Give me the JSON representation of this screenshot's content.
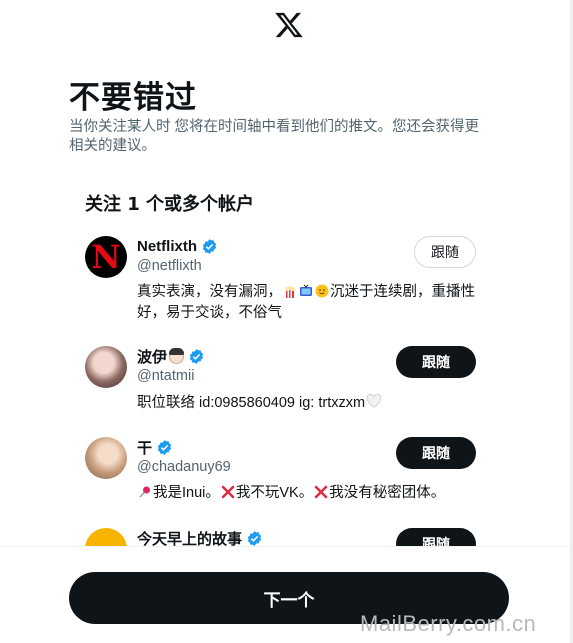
{
  "header": {
    "logo_icon": "x-logo-icon"
  },
  "intro": {
    "headline": "不要错过",
    "subtext": "当你关注某人时 您将在时间轴中看到他们的推文。您还会获得更相关的建议。"
  },
  "section": {
    "title": "关注 1 个或多个帐户"
  },
  "accounts": [
    {
      "name": "Netflixth",
      "handle": "@netflixth",
      "bio_parts": [
        "真实表演，没有漏洞，",
        "沉迷于连续剧，重播性好，易于交谈，不俗气"
      ],
      "bio_emojis": [
        "popcorn-icon",
        "tv-icon",
        "slightly-smiling-face-icon"
      ],
      "button_label": "跟随",
      "button_state": "following-outline"
    },
    {
      "name": "波伊",
      "name_emoji": "woman-face-icon",
      "handle": "@ntatmii",
      "bio": "职位联络 id:0985860409 ig: trtxzxm",
      "bio_emoji": "white-heart-icon",
      "button_label": "跟随",
      "button_state": "solid"
    },
    {
      "name": "干",
      "handle": "@chadanuy69",
      "bio_parts": [
        "我是Inui。",
        "我不玩VK。",
        "我没有秘密团体。"
      ],
      "bio_emojis": [
        "pushpin-icon",
        "cross-mark-icon",
        "cross-mark-icon"
      ],
      "button_label": "跟随",
      "button_state": "solid"
    },
    {
      "name": "今天早上的故事",
      "button_label": "跟随",
      "button_state": "solid"
    }
  ],
  "footer": {
    "next_label": "下一个"
  },
  "watermark": "MailBerry.com.cn",
  "colors": {
    "primary_text": "#0f1419",
    "secondary_text": "#536471",
    "verified": "#1d9bf0",
    "netflix_red": "#e50914"
  }
}
